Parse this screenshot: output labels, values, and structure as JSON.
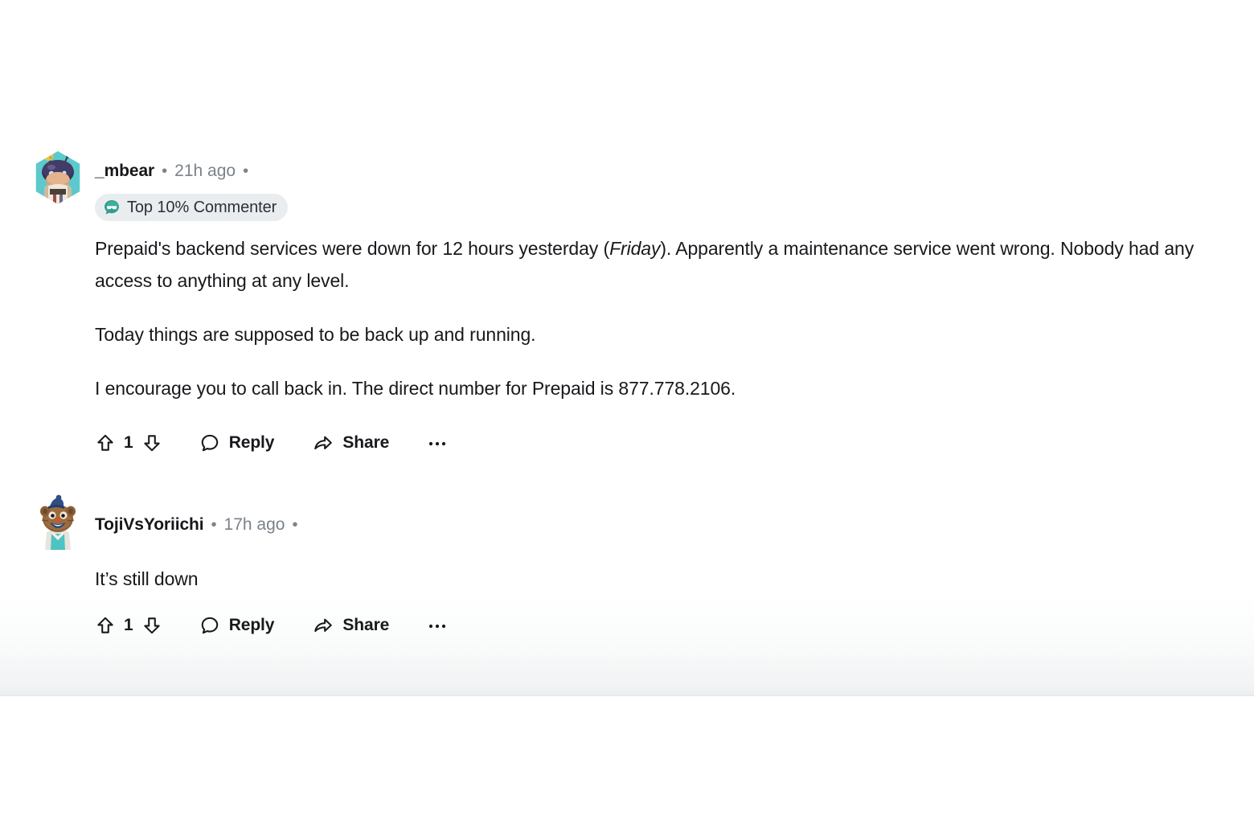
{
  "theme": {
    "page_background": "#ffffff",
    "text_primary": "#17191c",
    "text_muted": "#7c828a",
    "badge_background": "#eaedef",
    "badge_icon_color": "#2c9a8a",
    "divider": "#e4e6e7",
    "fade_end": "#eceff0"
  },
  "comments": [
    {
      "id": "comment-mbear",
      "author": "_mbear",
      "separator": "•",
      "timestamp": "21h ago",
      "trailing_separator": "•",
      "avatar": {
        "name": "user-avatar-mbear",
        "description": "hexagon-framed avatar of a purple-haired character in a teal frame",
        "frame_color": "#4fc5c5",
        "background_color": "#59c8cd"
      },
      "badge": {
        "icon": "commenter-speech-bubble-icon",
        "label": "Top 10% Commenter"
      },
      "body_paragraphs": [
        {
          "segments": [
            {
              "text": "Prepaid's backend services were down for 12 hours yesterday (",
              "style": "normal"
            },
            {
              "text": "Friday",
              "style": "italic"
            },
            {
              "text": "). Apparently a maintenance service went wrong. Nobody had any access to anything at any level.",
              "style": "normal"
            }
          ]
        },
        {
          "segments": [
            {
              "text": "Today things are supposed to be back up and running.",
              "style": "normal"
            }
          ]
        },
        {
          "segments": [
            {
              "text": "I encourage you to call back in. The direct number for Prepaid is 877.778.2106.",
              "style": "normal"
            }
          ]
        }
      ],
      "actions": {
        "upvote_icon": "upvote-arrow-icon",
        "vote_count": "1",
        "downvote_icon": "downvote-arrow-icon",
        "reply_icon": "comment-bubble-icon",
        "reply_label": "Reply",
        "share_icon": "share-arrow-icon",
        "share_label": "Share",
        "more_icon": "overflow-dots-icon"
      }
    },
    {
      "id": "comment-toji",
      "author": "TojiVsYoriichi",
      "separator": "•",
      "timestamp": "17h ago",
      "trailing_separator": "•",
      "avatar": {
        "name": "user-avatar-toji",
        "description": "brown bear character with blue cap, white mask and teal shirt",
        "frame_color": "#ffffff",
        "background_color": "#ffffff"
      },
      "badge": null,
      "body_paragraphs": [
        {
          "segments": [
            {
              "text": "It’s still down",
              "style": "normal"
            }
          ]
        }
      ],
      "actions": {
        "upvote_icon": "upvote-arrow-icon",
        "vote_count": "1",
        "downvote_icon": "downvote-arrow-icon",
        "reply_icon": "comment-bubble-icon",
        "reply_label": "Reply",
        "share_icon": "share-arrow-icon",
        "share_label": "Share",
        "more_icon": "overflow-dots-icon"
      }
    }
  ]
}
